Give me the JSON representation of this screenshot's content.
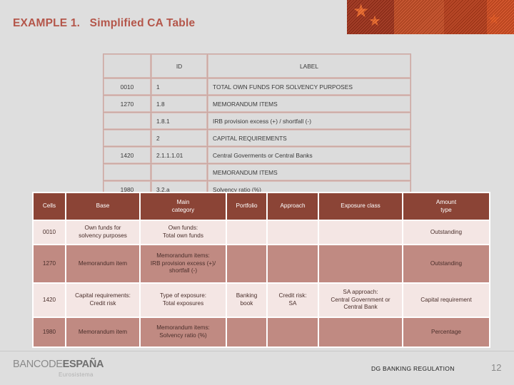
{
  "slide": {
    "title": "EXAMPLE 1.   Simplified CA Table",
    "title_color": "#b4564a",
    "background_color": "#dedede"
  },
  "banner": {
    "icon": "flag-stars-banner",
    "star_glyph": "★",
    "colors": [
      "#9c2f18",
      "#c24a22",
      "#b33a18",
      "#cf4a1e"
    ]
  },
  "top_table": {
    "headers": [
      "",
      "ID",
      "LABEL"
    ],
    "rows": [
      {
        "code": "0010",
        "id": "1",
        "label": "TOTAL OWN FUNDS FOR SOLVENCY PURPOSES"
      },
      {
        "code": "1270",
        "id": "1.8",
        "label": "MEMORANDUM ITEMS"
      },
      {
        "code": "",
        "id": "1.8.1",
        "label": "IRB provision excess (+) / shortfall (-)"
      },
      {
        "code": "",
        "id": "2",
        "label": "CAPITAL REQUIREMENTS"
      },
      {
        "code": "1420",
        "id": "2.1.1.1.01",
        "label": "Central Goverments or Central Banks"
      },
      {
        "code": "",
        "id": "",
        "label": "MEMORANDUM ITEMS"
      },
      {
        "code": "1980",
        "id": "3.2.a",
        "label": "Solvency ratio (%)"
      }
    ]
  },
  "bottom_table": {
    "headers": [
      "Cells",
      "Base",
      "Main\ncategory",
      "Portfolio",
      "Approach",
      "Exposure class",
      "Amount\ntype"
    ],
    "header_bg": "#8b4436",
    "row_light_bg": "#f4e6e4",
    "row_dark_bg": "#c08a82",
    "rows": [
      {
        "style": "light",
        "cells": "0010",
        "base": "Own funds for\nsolvency purposes",
        "main_category": "Own funds:\nTotal own funds",
        "portfolio": "",
        "approach": "",
        "exposure_class": "",
        "amount_type": "Outstanding"
      },
      {
        "style": "dark",
        "cells": "1270",
        "base": "Memorandum item",
        "main_category": "Memorandum items:\nIRB provision excess (+)/\nshortfall (-)",
        "portfolio": "",
        "approach": "",
        "exposure_class": "",
        "amount_type": "Outstanding"
      },
      {
        "style": "light",
        "cells": "1420",
        "base": "Capital requirements:\nCredit risk",
        "main_category": "Type of exposure:\nTotal exposures",
        "portfolio": "Banking\nbook",
        "approach": "Credit risk:\nSA",
        "exposure_class": "SA approach:\nCentral Government or\nCentral Bank",
        "amount_type": "Capital requirement"
      },
      {
        "style": "dark",
        "cells": "1980",
        "base": "Memorandum item",
        "main_category": "Memorandum items:\nSolvency ratio (%)",
        "portfolio": "",
        "approach": "",
        "exposure_class": "",
        "amount_type": "Percentage"
      }
    ]
  },
  "footer": {
    "logo_part1": "BANCODE",
    "logo_part2": "ESPAÑA",
    "logo_subtitle": "Eurosistema",
    "department": "DG BANKING REGULATION",
    "page_number": "12"
  }
}
